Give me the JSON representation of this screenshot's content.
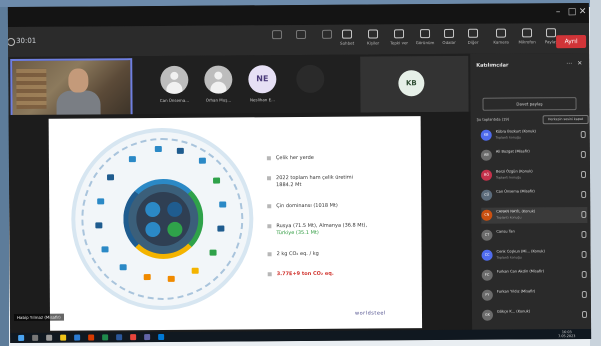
{
  "window": {
    "minimize": "–",
    "maximize": "□",
    "close": "✕"
  },
  "toolbar": {
    "timer": "30:01",
    "buttons": [
      {
        "label": "",
        "icon": "camera-icon",
        "dim": true
      },
      {
        "label": "",
        "icon": "mic-icon",
        "dim": true
      },
      {
        "label": "",
        "icon": "share-tray-icon",
        "dim": true
      },
      {
        "label": "Sohbet",
        "icon": "chat-icon",
        "dim": false
      },
      {
        "label": "Kişiler",
        "icon": "people-icon",
        "dim": false
      },
      {
        "label": "Tepki ver",
        "icon": "reaction-icon",
        "dim": false
      },
      {
        "label": "Görünüm",
        "icon": "view-icon",
        "dim": false
      },
      {
        "label": "Odalar",
        "icon": "rooms-icon",
        "dim": false
      },
      {
        "label": "Diğer",
        "icon": "more-icon",
        "dim": false
      },
      {
        "label": "Kamera",
        "icon": "video-icon",
        "dim": false
      },
      {
        "label": "Mikrofon",
        "icon": "microphone-icon",
        "dim": false
      },
      {
        "label": "Paylaş",
        "icon": "share-icon",
        "dim": false
      }
    ],
    "leave_label": "Ayrıl"
  },
  "strip": {
    "tiles": [
      {
        "name": "Can Ünsema...",
        "initials": "",
        "style": "photo"
      },
      {
        "name": "Orhan Muş...",
        "initials": "",
        "style": "photo"
      },
      {
        "name": "Neslihan E...",
        "initials": "NE",
        "style": "initials"
      },
      {
        "name": "",
        "initials": "",
        "style": "dark"
      }
    ],
    "kb_initials": "KB"
  },
  "presenter_name": "Habip Yılmaz (Misafir)",
  "slide": {
    "bullets": [
      {
        "text": "Çelik her yerde",
        "cls": ""
      },
      {
        "text": "2022 toplam ham çelik üretimi",
        "cls": "",
        "line2": "1884.2 Mt"
      },
      {
        "text": "Çin dominansı (1018 Mt)",
        "cls": ""
      },
      {
        "text": "Rusya (71.5 Mt), Almanya (36.8 Mt),",
        "cls": "",
        "line2": "Türkiye (35.1 Mt)"
      },
      {
        "text": "2 kg CO₂ eq. / kg",
        "cls": ""
      },
      {
        "text": "3.77E+9 ton CO₂ eq.",
        "cls": "red"
      }
    ],
    "logo": "worldsteel"
  },
  "panel": {
    "title": "Katılımcılar",
    "share_invite": "Davet paylaş",
    "mute_all": "Herkesin sesini kapat",
    "section": "Şu toplantıda (19)",
    "participants": [
      {
        "initials": "KB",
        "name": "Kübra Bozkurt (Konuk)",
        "role": "Toplantı konuğu",
        "color": "#4f6bed"
      },
      {
        "initials": "AB",
        "name": "Ali Bozgat (Misafir)",
        "role": "",
        "color": "#6b6b6b"
      },
      {
        "initials": "BÖ",
        "name": "Berzi Özgün (Konuk)",
        "role": "Toplantı konuğu",
        "color": "#c4314b"
      },
      {
        "initials": "CÜ",
        "name": "Can Ünsema (Misafir)",
        "role": "",
        "color": "#5b6b7b"
      },
      {
        "initials": "CN",
        "name": "CANAN NAYİL (Konuk)",
        "role": "Toplantı konuğu",
        "color": "#ca5010"
      },
      {
        "initials": "CT",
        "name": "Cansu Tan",
        "role": "",
        "color": "#6b6b6b"
      },
      {
        "initials": "CC",
        "name": "Cenk Coşkun (Mi... (Konuk)",
        "role": "Toplantı konuğu",
        "color": "#4f6bed"
      },
      {
        "initials": "FC",
        "name": "Furkan Can Akdin (Misafir)",
        "role": "",
        "color": "#6b6b6b"
      },
      {
        "initials": "FY",
        "name": "Furkan Yıldız (Misafir)",
        "role": "",
        "color": "#6b6b6b"
      },
      {
        "initials": "GK",
        "name": "Gökçe K... (Konuk)",
        "role": "",
        "color": "#6b6b6b"
      }
    ]
  },
  "taskbar": {
    "time": "16:03",
    "date": "7.05.2023"
  }
}
